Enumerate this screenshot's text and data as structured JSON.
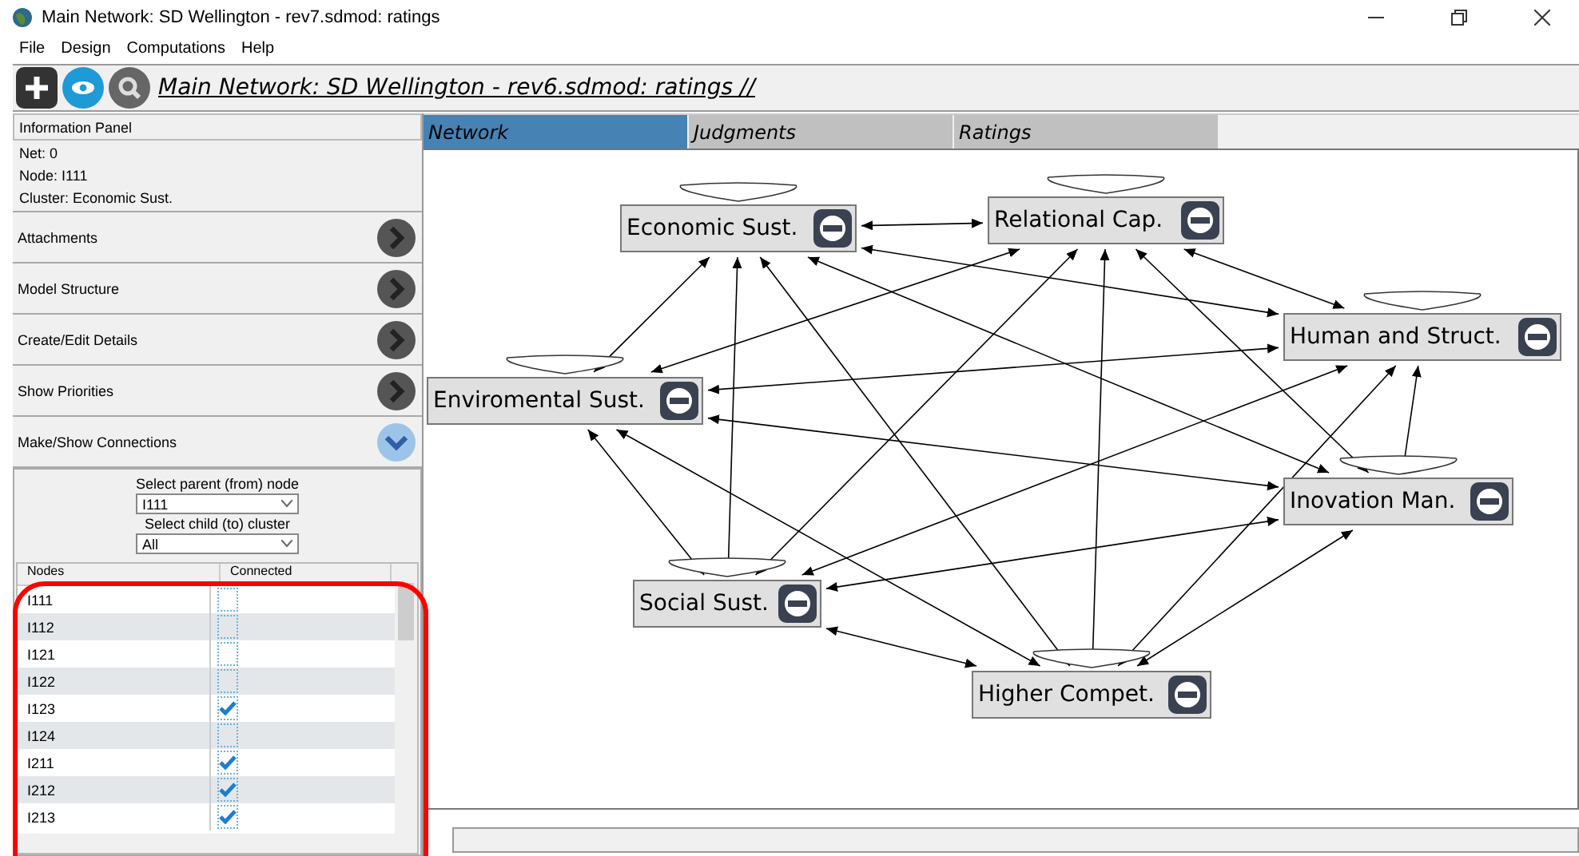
{
  "window": {
    "title": "Main Network: SD Wellington - rev7.sdmod: ratings"
  },
  "menu": [
    "File",
    "Design",
    "Computations",
    "Help"
  ],
  "toolbar": {
    "title": "Main Network: SD Wellington - rev6.sdmod: ratings //"
  },
  "info_panel": {
    "title": "Information Panel",
    "lines": [
      "Net: 0",
      "Node: I111",
      "Cluster: Economic Sust."
    ]
  },
  "sections": [
    {
      "label": "Attachments",
      "expanded": false
    },
    {
      "label": "Model Structure",
      "expanded": false
    },
    {
      "label": "Create/Edit Details",
      "expanded": false
    },
    {
      "label": "Show Priorities",
      "expanded": false
    },
    {
      "label": "Make/Show Connections",
      "expanded": true
    }
  ],
  "connections": {
    "parent_label": "Select parent (from) node",
    "parent_value": "I111",
    "child_label": "Select child (to) cluster",
    "child_value": "All",
    "columns": [
      "Nodes",
      "Connected"
    ],
    "rows": [
      {
        "node": "I111",
        "connected": false
      },
      {
        "node": "I112",
        "connected": false
      },
      {
        "node": "I121",
        "connected": false
      },
      {
        "node": "I122",
        "connected": false
      },
      {
        "node": "I123",
        "connected": true
      },
      {
        "node": "I124",
        "connected": false
      },
      {
        "node": "I211",
        "connected": true
      },
      {
        "node": "I212",
        "connected": true
      },
      {
        "node": "I213",
        "connected": true
      }
    ]
  },
  "tabs": [
    {
      "label": "Network",
      "selected": true
    },
    {
      "label": "Judgments",
      "selected": false
    },
    {
      "label": "Ratings",
      "selected": false
    }
  ],
  "network": {
    "nodes": [
      {
        "label": "Economic Sust.",
        "self_loop": true
      },
      {
        "label": "Relational Cap.",
        "self_loop": true
      },
      {
        "label": "Human and Struct.",
        "self_loop": true
      },
      {
        "label": "Enviromental Sust.",
        "self_loop": true
      },
      {
        "label": "Inovation Man.",
        "self_loop": true
      },
      {
        "label": "Social Sust.",
        "self_loop": true
      },
      {
        "label": "Higher Compet.",
        "self_loop": true
      }
    ]
  }
}
